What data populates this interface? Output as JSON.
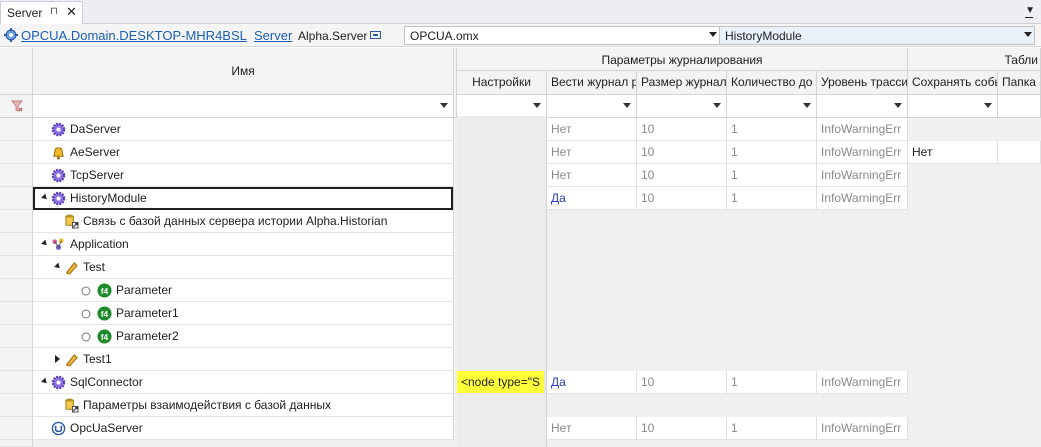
{
  "tab": {
    "title": "Server",
    "pin_glyph": "⊓",
    "close_glyph": "✕"
  },
  "path": {
    "domain_link": "OPCUA.Domain.DESKTOP-MHR4BSL",
    "server_link": "Server",
    "server_name": "Alpha.Server",
    "file_combo": "OPCUA.omx",
    "module_combo": "HistoryModule"
  },
  "grid": {
    "name_header": "Имя",
    "group_header": "Параметры журналирования",
    "group2_header": "Табли",
    "columns": [
      "Настройки",
      "Вести журнал р",
      "Размер журнал",
      "Количество до",
      "Уровень трасси",
      "Сохранять собы",
      "Папка"
    ],
    "rows": [
      {
        "label": "DaServer",
        "icon": "gear-icon",
        "values": [
          "",
          "Нет",
          "10",
          "1",
          "InfoWarningErr",
          "",
          ""
        ]
      },
      {
        "label": "AeServer",
        "icon": "bell-icon",
        "values": [
          "",
          "Нет",
          "10",
          "1",
          "InfoWarningErr",
          "Нет",
          ""
        ]
      },
      {
        "label": "TcpServer",
        "icon": "gear-icon",
        "values": [
          "",
          "Нет",
          "10",
          "1",
          "InfoWarningErr",
          "",
          ""
        ]
      },
      {
        "label": "HistoryModule",
        "icon": "gear-icon",
        "values": [
          "",
          "Да",
          "10",
          "1",
          "InfoWarningErr",
          "",
          ""
        ]
      },
      {
        "label": "Связь с базой данных сервера истории Alpha.Historian",
        "icon": "database-link-icon"
      },
      {
        "label": "Application",
        "icon": "application-icon"
      },
      {
        "label": "Test",
        "icon": "folder-tag-icon"
      },
      {
        "label": "Parameter",
        "icon": "f4-icon"
      },
      {
        "label": "Parameter1",
        "icon": "f4-icon"
      },
      {
        "label": "Parameter2",
        "icon": "f4-icon"
      },
      {
        "label": "Test1",
        "icon": "folder-tag-icon"
      },
      {
        "label": "SqlConnector",
        "icon": "gear-icon",
        "values": [
          "<node type=\"S",
          "Да",
          "10",
          "1",
          "InfoWarningErr",
          "",
          ""
        ]
      },
      {
        "label": "Параметры взаимодействия с базой данных",
        "icon": "database-link-icon"
      },
      {
        "label": "OpcUaServer",
        "icon": "opcua-icon",
        "values": [
          "",
          "Нет",
          "10",
          "1",
          "InfoWarningErr",
          "",
          ""
        ]
      }
    ]
  },
  "colors": {
    "link": "#1a5eb5",
    "highlight": "#ffff3a",
    "yes_value": "#2a3fbf",
    "gear": "#7a5bd6",
    "f4_green": "#1f8a2a"
  }
}
